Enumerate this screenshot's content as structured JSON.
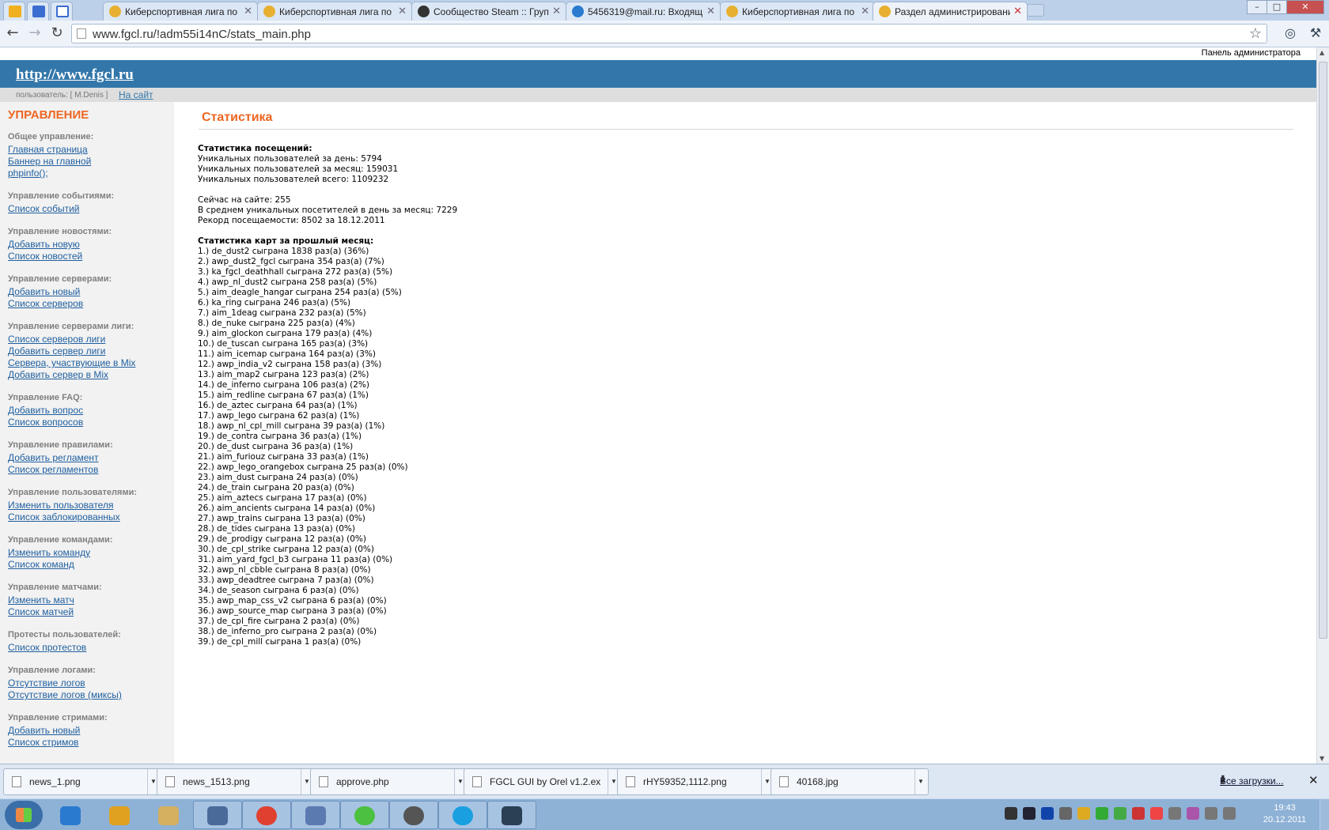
{
  "browser": {
    "tabs": [
      {
        "title": "Киберспортивная лига по",
        "active": false
      },
      {
        "title": "Киберспортивная лига по",
        "active": false
      },
      {
        "title": "Сообщество Steam :: Груп",
        "active": false
      },
      {
        "title": "5456319@mail.ru: Входящи",
        "active": false
      },
      {
        "title": "Киберспортивная лига по",
        "active": false
      },
      {
        "title": "Раздел администрировани",
        "active": true
      }
    ],
    "pinned_tabs": [
      "tut-icon",
      "calendar-icon",
      "docs-icon"
    ],
    "address": "www.fgcl.ru/!adm55i14nC/stats_main.php",
    "window_controls": {
      "minimize": "–",
      "maximize": "□",
      "close": "✕"
    }
  },
  "page": {
    "admin_panel_label": "Панель администратора",
    "site_link": "http://www.fgcl.ru",
    "user_label": "пользователь: [ M.Denis ]",
    "to_site_link": "На сайт",
    "sidebar_title": "УПРАВЛЕНИЕ",
    "sidebar_groups": [
      {
        "title": "Общее управление:",
        "links": [
          "Главная страница",
          "Баннер на главной",
          "phpinfo();"
        ]
      },
      {
        "title": "Управление событиями:",
        "links": [
          "Список событий"
        ]
      },
      {
        "title": "Управление новостями:",
        "links": [
          "Добавить новую",
          "Список новостей"
        ]
      },
      {
        "title": "Управление серверами:",
        "links": [
          "Добавить новый",
          "Список серверов"
        ]
      },
      {
        "title": "Управление серверами лиги:",
        "links": [
          "Список серверов лиги",
          "Добавить сервер лиги",
          "Сервера, участвующие в Mix",
          "Добавить сервер в Mix"
        ]
      },
      {
        "title": "Управление FAQ:",
        "links": [
          "Добавить вопрос",
          "Список вопросов"
        ]
      },
      {
        "title": "Управление правилами:",
        "links": [
          "Добавить регламент",
          "Список регламентов"
        ]
      },
      {
        "title": "Управление пользователями:",
        "links": [
          "Изменить пользователя",
          "Список заблокированных"
        ]
      },
      {
        "title": "Управление командами:",
        "links": [
          "Изменить команду",
          "Список команд"
        ]
      },
      {
        "title": "Управление матчами:",
        "links": [
          "Изменить матч",
          "Список матчей"
        ]
      },
      {
        "title": "Протесты пользователей:",
        "links": [
          "Список протестов"
        ]
      },
      {
        "title": "Управление логами:",
        "links": [
          "Отсутствие логов",
          "Отсутствие логов (миксы)"
        ]
      },
      {
        "title": "Управление стримами:",
        "links": [
          "Добавить новый",
          "Список стримов"
        ]
      }
    ],
    "title": "Статистика",
    "visits_heading": "Статистика посещений:",
    "visits_lines": [
      "Уникальных пользователей за день: 5794",
      "Уникальных пользователей за месяц: 159031",
      "Уникальных пользователей всего: 1109232"
    ],
    "now_lines": [
      "Сейчас на сайте: 255",
      "В среднем уникальных посетителей в день за месяц: 7229",
      "Рекорд посещаемости: 8502 за 18.12.2011"
    ],
    "maps_heading": "Статистика карт за прошлый месяц:",
    "maps": [
      "1.) de_dust2 сыграна 1838 раз(а) (36%)",
      "2.) awp_dust2_fgcl сыграна 354 раз(а) (7%)",
      "3.) ka_fgcl_deathhall сыграна 272 раз(а) (5%)",
      "4.) awp_nl_dust2 сыграна 258 раз(а) (5%)",
      "5.) aim_deagle_hangar сыграна 254 раз(а) (5%)",
      "6.) ka_ring сыграна 246 раз(а) (5%)",
      "7.) aim_1deag сыграна 232 раз(а) (5%)",
      "8.) de_nuke сыграна 225 раз(а) (4%)",
      "9.) aim_glockon сыграна 179 раз(а) (4%)",
      "10.) de_tuscan сыграна 165 раз(а) (3%)",
      "11.) aim_icemap сыграна 164 раз(а) (3%)",
      "12.) awp_india_v2 сыграна 158 раз(а) (3%)",
      "13.) aim_map2 сыграна 123 раз(а) (2%)",
      "14.) de_inferno сыграна 106 раз(а) (2%)",
      "15.) aim_redline сыграна 67 раз(а) (1%)",
      "16.) de_aztec сыграна 64 раз(а) (1%)",
      "17.) awp_lego сыграна 62 раз(а) (1%)",
      "18.) awp_nl_cpl_mill сыграна 39 раз(а) (1%)",
      "19.) de_contra сыграна 36 раз(а) (1%)",
      "20.) de_dust сыграна 36 раз(а) (1%)",
      "21.) aim_furiouz сыграна 33 раз(а) (1%)",
      "22.) awp_lego_orangebox сыграна 25 раз(а) (0%)",
      "23.) aim_dust сыграна 24 раз(а) (0%)",
      "24.) de_train сыграна 20 раз(а) (0%)",
      "25.) aim_aztecs сыграна 17 раз(а) (0%)",
      "26.) aim_ancients сыграна 14 раз(а) (0%)",
      "27.) awp_trains сыграна 13 раз(а) (0%)",
      "28.) de_tides сыграна 13 раз(а) (0%)",
      "29.) de_prodigy сыграна 12 раз(а) (0%)",
      "30.) de_cpl_strike сыграна 12 раз(а) (0%)",
      "31.) aim_yard_fgcl_b3 сыграна 11 раз(а) (0%)",
      "32.) awp_nl_cbble сыграна 8 раз(а) (0%)",
      "33.) awp_deadtree сыграна 7 раз(а) (0%)",
      "34.) de_season сыграна 6 раз(а) (0%)",
      "35.) awp_map_css_v2 сыграна 6 раз(а) (0%)",
      "36.) awp_source_map сыграна 3 раз(а) (0%)",
      "37.) de_cpl_fire сыграна 2 раз(а) (0%)",
      "38.) de_inferno_pro сыграна 2 раз(а) (0%)",
      "39.) de_cpl_mill сыграна 1 раз(а) (0%)"
    ]
  },
  "downloads": {
    "items": [
      "news_1.png",
      "news_1513.png",
      "approve.php",
      "FGCL GUI by Orel v1.2.exe",
      "rHY59352,1112.png",
      "40168.jpg"
    ],
    "all_downloads": "Все загрузки...",
    "close": "✕"
  },
  "taskbar": {
    "apps": [
      "ie-icon",
      "ghost-icon",
      "explorer-icon",
      "terminal-icon",
      "chrome-icon",
      "network-icon",
      "icq-icon",
      "dle-icon",
      "skype-icon",
      "steam-icon"
    ],
    "time": "19:43",
    "date": "20.12.2011"
  },
  "colors": {
    "header_blue": "#3377aa",
    "accent_orange": "#ee6622",
    "link_blue": "#2060a0"
  }
}
